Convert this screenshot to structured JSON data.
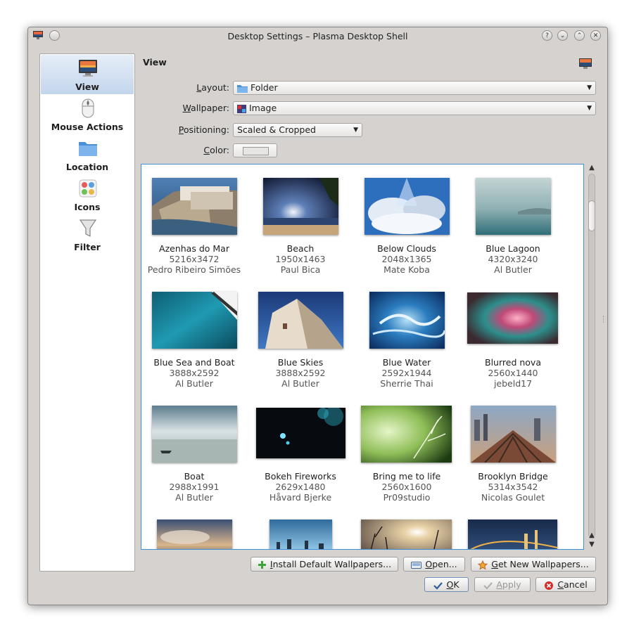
{
  "window": {
    "title": "Desktop Settings – Plasma Desktop Shell",
    "buttons": [
      "?",
      "⌄",
      "⌃",
      "✕"
    ]
  },
  "sidebar": {
    "items": [
      {
        "label": "View",
        "icon": "monitor-icon",
        "active": true
      },
      {
        "label": "Mouse Actions",
        "icon": "mouse-icon",
        "active": false
      },
      {
        "label": "Location",
        "icon": "folder-icon",
        "active": false
      },
      {
        "label": "Icons",
        "icon": "icons-icon",
        "active": false
      },
      {
        "label": "Filter",
        "icon": "funnel-icon",
        "active": false
      }
    ]
  },
  "page": {
    "title": "View"
  },
  "form": {
    "layout_label_pre": "",
    "layout_label_u": "L",
    "layout_label_post": "ayout:",
    "layout_value": "Folder",
    "wallpaper_label_u": "W",
    "wallpaper_label_post": "allpaper:",
    "wallpaper_value": "Image",
    "positioning_label_u": "P",
    "positioning_label_post": "ositioning:",
    "positioning_value": "Scaled & Cropped",
    "color_label_u": "C",
    "color_label_post": "olor:",
    "color_value": "#e6e5e4"
  },
  "wallpapers": [
    {
      "name": "Azenhas do Mar",
      "size": "5216x3472",
      "author": "Pedro Ribeiro Simões"
    },
    {
      "name": "Beach",
      "size": "1950x1463",
      "author": "Paul Bica"
    },
    {
      "name": "Below Clouds",
      "size": "2048x1365",
      "author": "Mate Koba"
    },
    {
      "name": "Blue Lagoon",
      "size": "4320x3240",
      "author": "Al Butler"
    },
    {
      "name": "Blue Sea and Boat",
      "size": "3888x2592",
      "author": "Al Butler"
    },
    {
      "name": "Blue Skies",
      "size": "3888x2592",
      "author": "Al Butler"
    },
    {
      "name": "Blue Water",
      "size": "2592x1944",
      "author": "Sherrie Thai"
    },
    {
      "name": "Blurred nova",
      "size": "2560x1440",
      "author": "jebeld17"
    },
    {
      "name": "Boat",
      "size": "2988x1991",
      "author": "Al Butler"
    },
    {
      "name": "Bokeh Fireworks",
      "size": "2629x1480",
      "author": "Håvard Bjerke"
    },
    {
      "name": "Bring me to life",
      "size": "2560x1600",
      "author": "Pr09studio"
    },
    {
      "name": "Brooklyn Bridge",
      "size": "5314x3542",
      "author": "Nicolas Goulet"
    }
  ],
  "buttons": {
    "install_u": "I",
    "install_post": "nstall Default Wallpapers...",
    "open_u": "O",
    "open_post": "pen...",
    "get_new_u": "G",
    "get_new_post": "et New Wallpapers...",
    "ok_u": "O",
    "ok_post": "K",
    "apply_u": "A",
    "apply_post": "pply",
    "cancel_u": "C",
    "cancel_post": "ancel"
  }
}
